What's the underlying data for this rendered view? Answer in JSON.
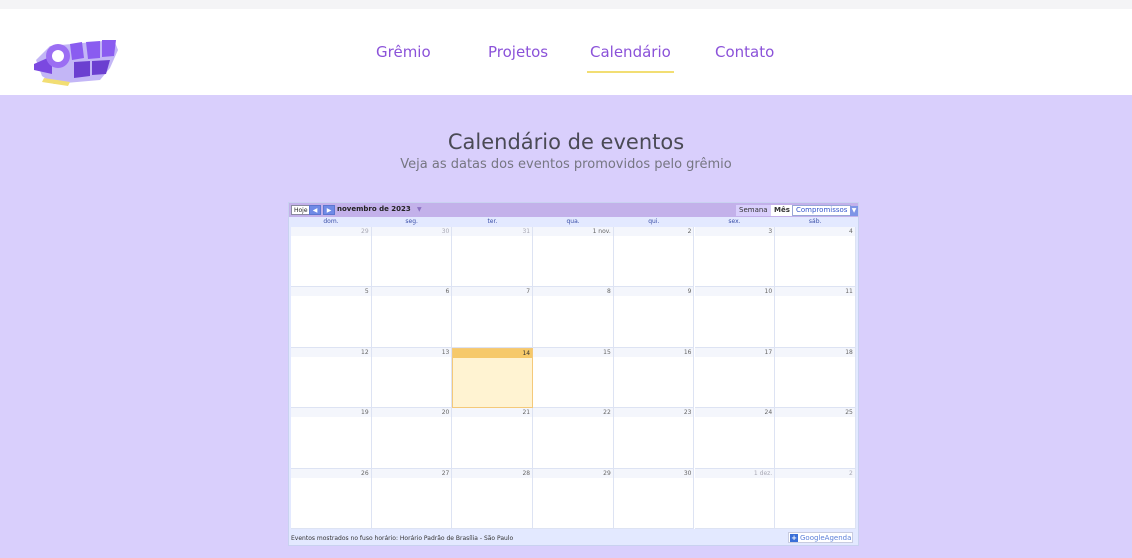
{
  "nav": {
    "items": [
      "Grêmio",
      "Projetos",
      "Calendário",
      "Contato"
    ],
    "active_index": 2
  },
  "page": {
    "title": "Calendário de eventos",
    "subtitle": "Veja as datas dos eventos promovidos pelo grêmio"
  },
  "calendar": {
    "today_label": "Hoje",
    "prev_icon": "chevron-left-icon",
    "next_icon": "chevron-right-icon",
    "month": "novembro de 2023",
    "month_dropdown_icon": "triangle-down-icon",
    "views": [
      "Semana",
      "Mês",
      "Compromissos"
    ],
    "selected_view": "Mês",
    "weekdays": [
      "dom.",
      "seg.",
      "ter.",
      "qua.",
      "qui.",
      "sex.",
      "sáb."
    ],
    "weeks": [
      [
        "29",
        "30",
        "31",
        "1 nov.",
        "2",
        "3",
        "4"
      ],
      [
        "5",
        "6",
        "7",
        "8",
        "9",
        "10",
        "11"
      ],
      [
        "12",
        "13",
        "14",
        "15",
        "16",
        "17",
        "18"
      ],
      [
        "19",
        "20",
        "21",
        "22",
        "23",
        "24",
        "25"
      ],
      [
        "26",
        "27",
        "28",
        "29",
        "30",
        "1 dez.",
        "2"
      ]
    ],
    "today": "14",
    "timezone_note": "Eventos mostrados no fuso horário: Horário Padrão de Brasília - São Paulo",
    "badge_text": "GoogleAgenda",
    "badge_icon": "plus-icon"
  },
  "colors": {
    "accent": "#8b52d9",
    "background": "#d9cffc",
    "nav_underline": "#f2de73",
    "today_highlight": "#fff3d2"
  }
}
